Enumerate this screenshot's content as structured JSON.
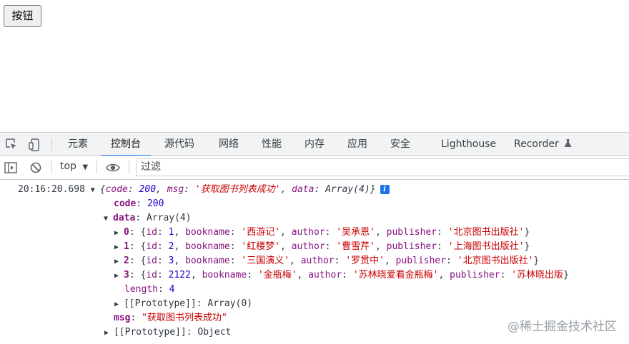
{
  "page": {
    "button_label": "按钮"
  },
  "devtools": {
    "tabs": [
      "元素",
      "控制台",
      "源代码",
      "网络",
      "性能",
      "内存",
      "应用",
      "安全",
      "Lighthouse",
      "Recorder"
    ],
    "active_tab": "控制台",
    "toolbar": {
      "context": "top",
      "filter_placeholder": "过滤"
    },
    "colors": {
      "accent": "#1a73e8",
      "key": "#881280",
      "string": "#c80000",
      "number": "#1c00cf"
    }
  },
  "console": {
    "timestamp": "20:16:20.698",
    "summary": {
      "open": "{",
      "code_key": "code",
      "code_val": "200",
      "msg_key": "msg",
      "msg_val": "'获取图书列表成功'",
      "data_key": "data",
      "data_val": "Array(4)",
      "close": "}"
    },
    "code_row": {
      "key": "code",
      "value": "200"
    },
    "data_row": {
      "key": "data",
      "value": "Array(4)"
    },
    "items": [
      {
        "index": "0",
        "id": "1",
        "bookname": "'西游记'",
        "author": "'吴承恩'",
        "publisher": "'北京图书出版社'"
      },
      {
        "index": "1",
        "id": "2",
        "bookname": "'红楼梦'",
        "author": "'曹雪芹'",
        "publisher": "'上海图书出版社'"
      },
      {
        "index": "2",
        "id": "3",
        "bookname": "'三国演义'",
        "author": "'罗贯中'",
        "publisher": "'北京图书出版社'"
      },
      {
        "index": "3",
        "id": "2122",
        "bookname": "'金瓶梅'",
        "author": "'苏林晓爱看金瓶梅'",
        "publisher": "'苏林晓出版"
      }
    ],
    "length_row": {
      "key": "length",
      "value": "4"
    },
    "array_proto": {
      "key": "[[Prototype]]",
      "value": "Array(0)"
    },
    "msg_row": {
      "key": "msg",
      "value": "\"获取图书列表成功\""
    },
    "object_proto": {
      "key": "[[Prototype]]",
      "value": "Object"
    }
  },
  "watermark": "@稀土掘金技术社区"
}
